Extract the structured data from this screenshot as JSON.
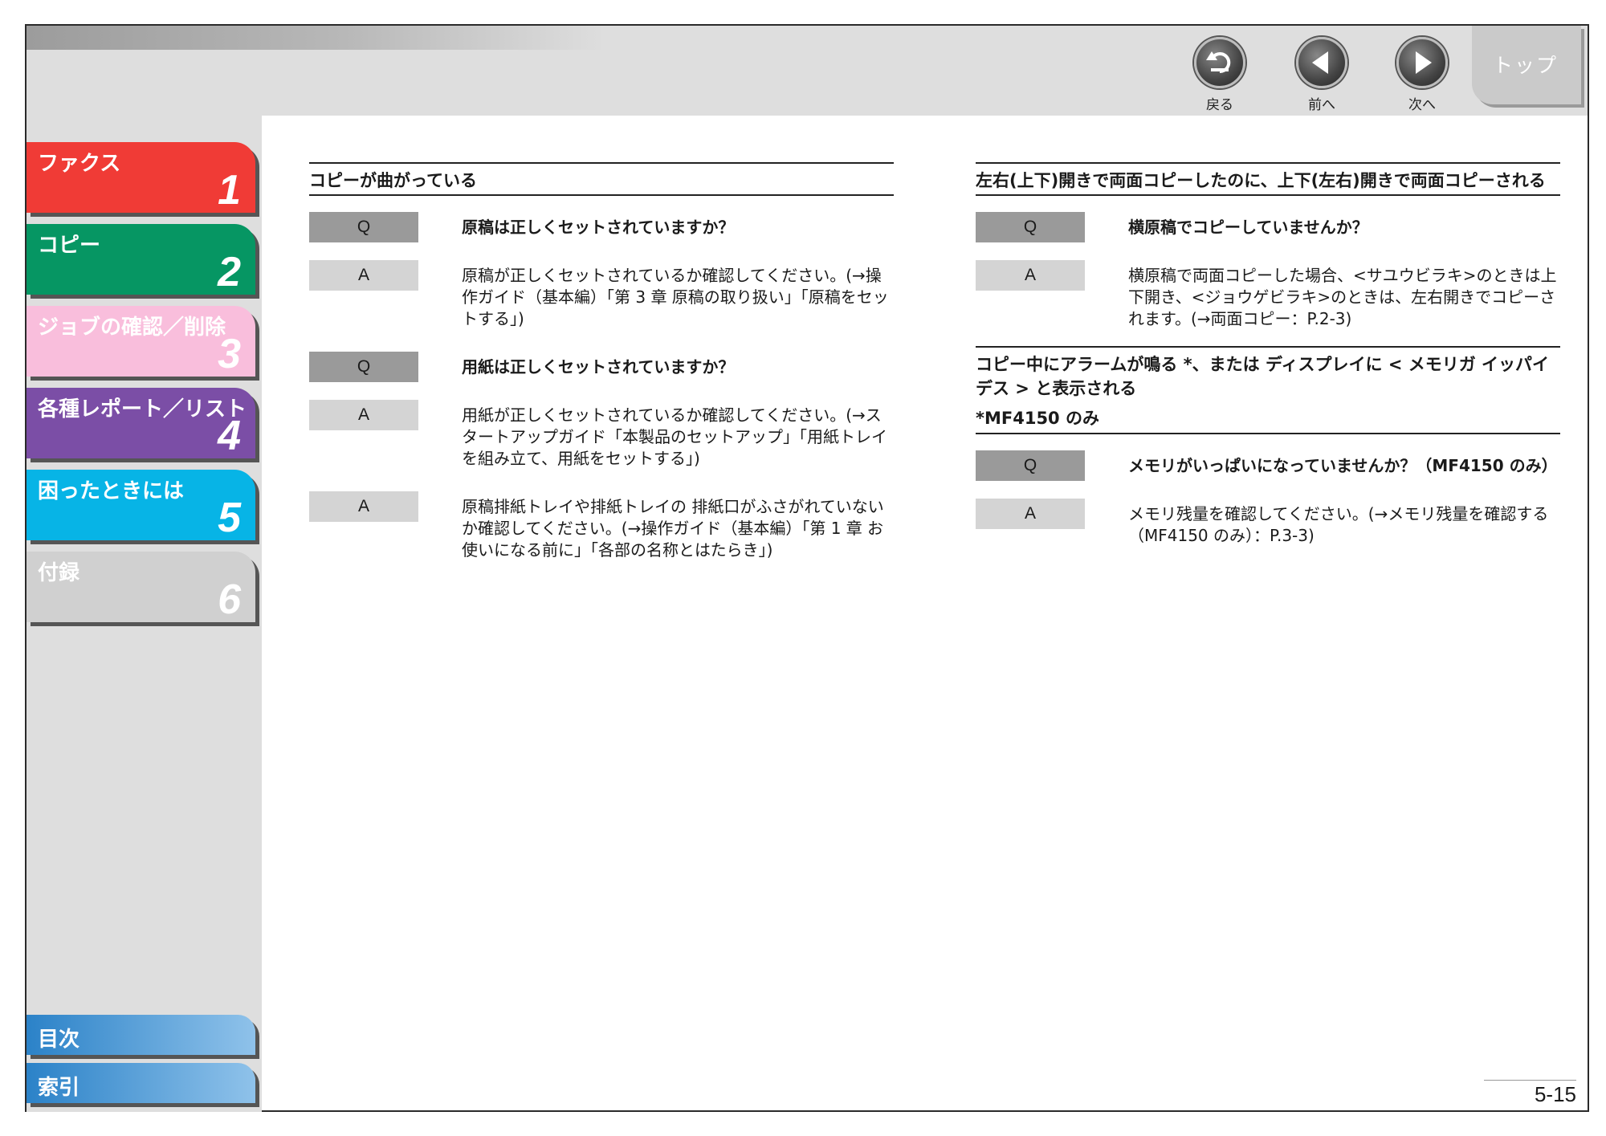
{
  "nav": {
    "back": "戻る",
    "prev": "前へ",
    "next": "次へ",
    "top": "トップ"
  },
  "sidebar": {
    "chapters": [
      {
        "name": "ファクス",
        "num": "1",
        "color": "#f03b36"
      },
      {
        "name": "コピー",
        "num": "2",
        "color": "#069663"
      },
      {
        "name": "ジョブの確認／削除",
        "num": "3",
        "color": "#f9bedc"
      },
      {
        "name": "各種レポート／リスト",
        "num": "4",
        "color": "#7b4ea6"
      },
      {
        "name": "困ったときには",
        "num": "5",
        "color": "#07b4e6"
      },
      {
        "name": "付録",
        "num": "6",
        "color": "#d0d0d0"
      }
    ],
    "toc": "目次",
    "index": "索引"
  },
  "left": {
    "title": "コピーが曲がっている",
    "rows": [
      {
        "tag": "Q",
        "text": "原稿は正しくセットされていますか？"
      },
      {
        "tag": "A",
        "text": "原稿が正しくセットされているか確認してください。(→操作ガイド（基本編）「第 3 章 原稿の取り扱い」「原稿をセットする」)"
      },
      {
        "tag": "Q",
        "text": "用紙は正しくセットされていますか？"
      },
      {
        "tag": "A",
        "text": "用紙が正しくセットされているか確認してください。(→スタートアップガイド「本製品のセットアップ」「用紙トレイを組み立て、用紙をセットする」)"
      },
      {
        "tag": "A",
        "text": "原稿排紙トレイや排紙トレイの 排紙口がふさがれていないか確認してください。(→操作ガイド（基本編）「第 1 章 お使いになる前に」「各部の名称とはたらき」)"
      }
    ]
  },
  "right": {
    "section1": {
      "title": "左右(上下)開きで両面コピーしたのに、上下(左右)開きで両面コピーされる",
      "rows": [
        {
          "tag": "Q",
          "text": "横原稿でコピーしていませんか？"
        },
        {
          "tag": "A",
          "text": "横原稿で両面コピーした場合、<サユウビラキ>のときは上下開き、<ジョウゲビラキ>のときは、左右開きでコピーされます。(→両面コピー：P.2-3)"
        }
      ]
    },
    "section2": {
      "title": "コピー中にアラームが鳴る *、または ディスプレイに < メモリガ イッパイデス > と表示される",
      "note": "*MF4150 のみ",
      "rows": [
        {
          "tag": "Q",
          "text": "メモリがいっぱいになっていませんか？（MF4150 のみ）"
        },
        {
          "tag": "A",
          "text": "メモリ残量を確認してください。(→メモリ残量を確認する（MF4150 のみ）：P.3-3)"
        }
      ]
    }
  },
  "page_number": "5-15"
}
